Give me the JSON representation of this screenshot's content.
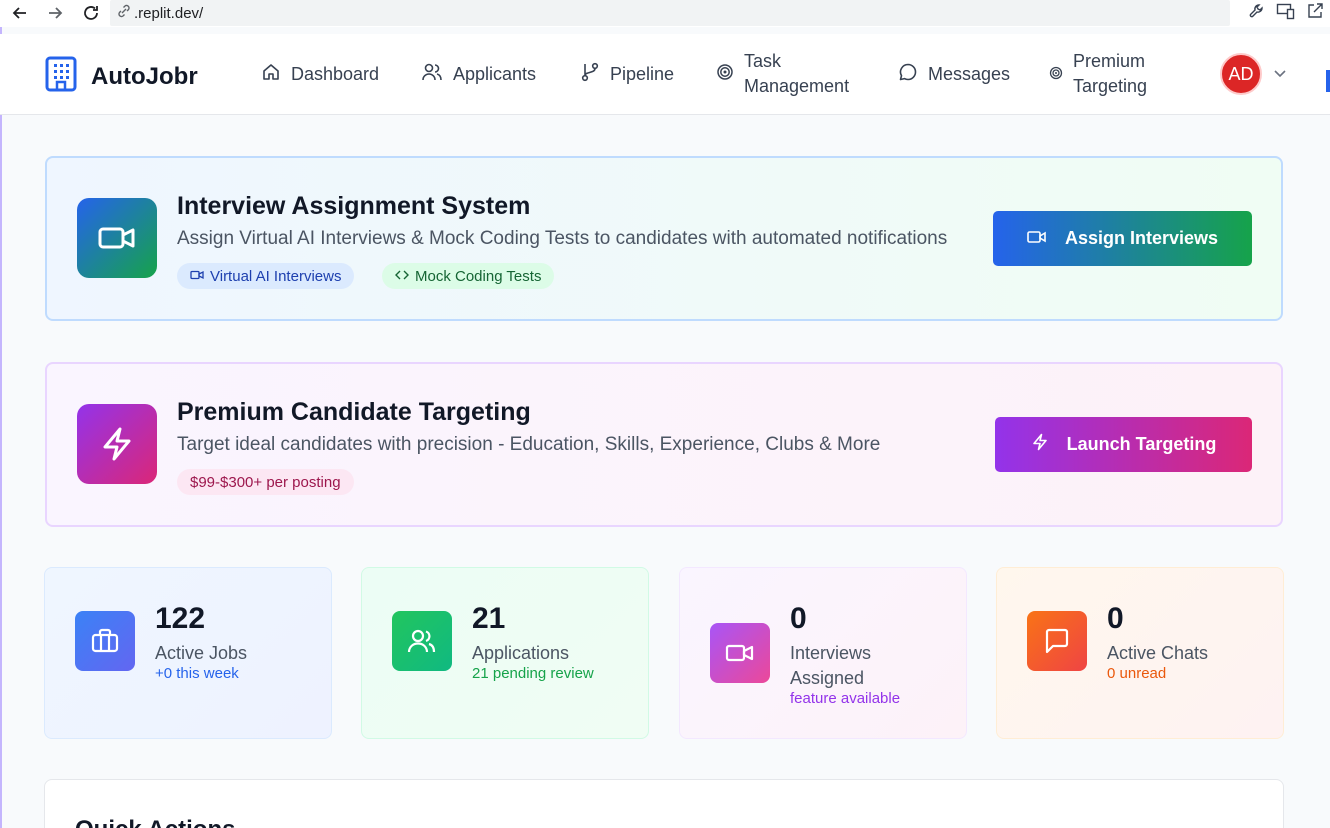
{
  "browser": {
    "url": ".replit.dev/"
  },
  "app": {
    "name": "AutoJobr"
  },
  "nav": [
    {
      "label": "Dashboard",
      "icon": "home-icon"
    },
    {
      "label": "Applicants",
      "icon": "users-icon"
    },
    {
      "label": "Pipeline",
      "icon": "git-branch-icon"
    },
    {
      "label": "Task Management",
      "icon": "target-icon"
    },
    {
      "label": "Messages",
      "icon": "message-circle-icon"
    },
    {
      "label": "Premium Targeting",
      "icon": "target-icon"
    }
  ],
  "user": {
    "initials": "AD"
  },
  "interview_banner": {
    "title": "Interview Assignment System",
    "subtitle": "Assign Virtual AI Interviews & Mock Coding Tests to candidates with automated notifications",
    "tags": [
      "Virtual AI Interviews",
      "Mock Coding Tests"
    ],
    "button": "Assign Interviews"
  },
  "premium_banner": {
    "title": "Premium Candidate Targeting",
    "subtitle": "Target ideal candidates with precision - Education, Skills, Experience, Clubs & More",
    "price_tag": "$99-$300+ per posting",
    "button": "Launch Targeting"
  },
  "stats": [
    {
      "value": "122",
      "label": "Active Jobs",
      "sub": "+0 this week",
      "icon": "briefcase-icon"
    },
    {
      "value": "21",
      "label": "Applications",
      "sub": "21 pending review",
      "icon": "users-icon"
    },
    {
      "value": "0",
      "label_line1": "Interviews",
      "label_line2": "Assigned",
      "sub": "feature available",
      "icon": "video-icon"
    },
    {
      "value": "0",
      "label": "Active Chats",
      "sub": "0 unread",
      "icon": "message-square-icon"
    }
  ],
  "quick_actions": {
    "title": "Quick Actions"
  },
  "colors": {
    "primary_blue": "#2563eb",
    "primary_green": "#16a34a",
    "purple": "#9333ea",
    "pink": "#db2777",
    "avatar_red": "#dc2626"
  }
}
